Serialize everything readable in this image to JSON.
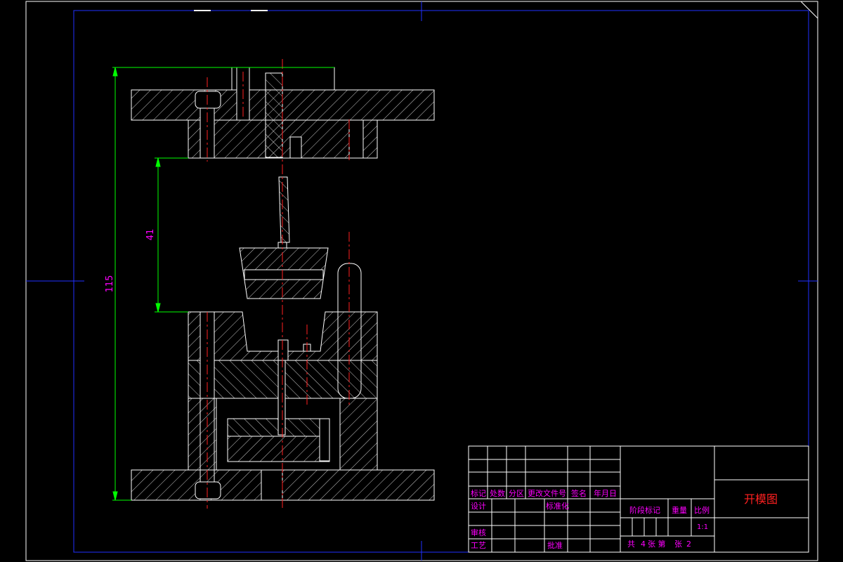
{
  "drawing": {
    "title": "开模图",
    "dimensions": {
      "overall_height": "115",
      "opening_gap": "41"
    }
  },
  "title_block": {
    "header_labels": [
      "标记",
      "处数",
      "分区",
      "更改文件号",
      "签名",
      "年月日"
    ],
    "design": "设计",
    "standardization": "标准化",
    "review": "审核",
    "process": "工艺",
    "approve": "批准",
    "stage_mark": "阶段标记",
    "weight": "重量",
    "scale_label": "比例",
    "scale_value": "1:1",
    "sheets_total_label": "共",
    "sheets_total": "4",
    "sheet_label": "张 第",
    "sheet_no_label": "张",
    "sheet_no": "2"
  },
  "colors": {
    "background": "#000000",
    "outline": "#ffffff",
    "hatch": "#ffffff",
    "centerline": "#ff2020",
    "dimension": "#00ff00",
    "dimension_text": "#ff00ff",
    "frame": "#0000ff",
    "title_text": "#ff2020",
    "block_text": "#ff00ff"
  }
}
